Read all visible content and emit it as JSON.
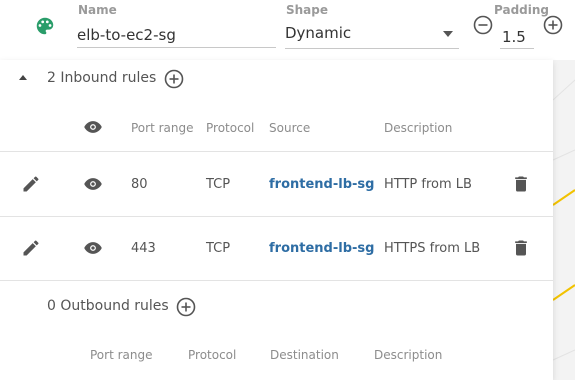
{
  "colors": {
    "accent": "#2e6da4",
    "palette_icon": "#2a9d6a",
    "canvas_line": "#f2c200"
  },
  "properties": {
    "name_label": "Name",
    "name_value": "elb-to-ec2-sg",
    "shape_label": "Shape",
    "shape_value": "Dynamic",
    "padding_label": "Padding",
    "padding_value": "1.5",
    "icons": [
      "palette-icon",
      "minus-circle-icon",
      "plus-circle-icon",
      "chevron-down-icon"
    ]
  },
  "inbound": {
    "title": "2 Inbound rules",
    "columns": {
      "port_range": "Port range",
      "protocol": "Protocol",
      "source": "Source",
      "description": "Description"
    },
    "rows": [
      {
        "port": "80",
        "protocol": "TCP",
        "source": "frontend-lb-sg",
        "description": "HTTP from LB"
      },
      {
        "port": "443",
        "protocol": "TCP",
        "source": "frontend-lb-sg",
        "description": "HTTPS from LB"
      }
    ],
    "icons": [
      "collapse-caret-icon",
      "add-circle-icon",
      "eye-icon",
      "pencil-icon",
      "trash-icon"
    ]
  },
  "outbound": {
    "title": "0 Outbound rules",
    "columns": {
      "port_range": "Port range",
      "protocol": "Protocol",
      "destination": "Destination",
      "description": "Description"
    },
    "icons": [
      "add-circle-icon"
    ]
  }
}
